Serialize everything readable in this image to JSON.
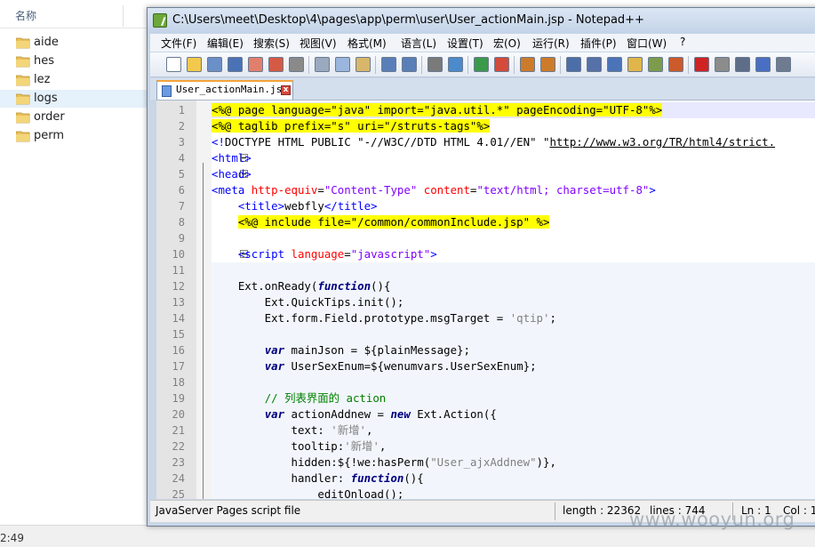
{
  "explorer": {
    "column_header": "名称",
    "folders": [
      "aide",
      "hes",
      "lez",
      "logs",
      "order",
      "perm"
    ],
    "selected_index": 3,
    "clock_fragment": "2:49"
  },
  "window": {
    "title": "C:\\Users\\meet\\Desktop\\4\\pages\\app\\perm\\user\\User_actionMain.jsp - Notepad++"
  },
  "menu": [
    "文件(F)",
    "编辑(E)",
    "搜索(S)",
    "视图(V)",
    "格式(M)",
    "语言(L)",
    "设置(T)",
    "宏(O)",
    "运行(R)",
    "插件(P)",
    "窗口(W)",
    "?"
  ],
  "toolbar": {
    "icons": [
      "new-file-icon",
      "open-file-icon",
      "save-icon",
      "save-all-icon",
      "close-icon",
      "close-all-icon",
      "print-icon",
      "cut-icon",
      "copy-icon",
      "paste-icon",
      "undo-icon",
      "redo-icon",
      "find-icon",
      "replace-icon",
      "zoom-in-icon",
      "zoom-out-icon",
      "sync-vertical-icon",
      "sync-horizontal-icon",
      "word-wrap-icon",
      "show-all-chars-icon",
      "indent-guide-icon",
      "user-lang-icon",
      "doc-map-icon",
      "function-list-icon",
      "record-macro-icon",
      "stop-macro-icon",
      "play-macro-icon",
      "run-macro-multiple-icon",
      "save-macro-icon"
    ]
  },
  "tab": {
    "label": "User_actionMain.jsp",
    "close": "x"
  },
  "editor": {
    "lines": [
      {
        "n": "1",
        "segs": [
          [
            "c-jsp",
            "<%@ page language=\"java\" import=\"java.util.*\" pageEncoding=\"UTF-8\"%>"
          ]
        ],
        "bg": "#e8e8ff"
      },
      {
        "n": "2",
        "segs": [
          [
            "c-jsp",
            "<%@ taglib prefix=\"s\" uri=\"/struts-tags\"%>"
          ]
        ],
        "bg": ""
      },
      {
        "n": "3",
        "segs": [
          [
            "c-tag",
            "<!"
          ],
          [
            "c-text",
            "DOCTYPE HTML PUBLIC \"-//W3C//DTD HTML 4.01//EN\" \""
          ],
          [
            "c-text",
            "http://www.w3.org/TR/html4/strict."
          ]
        ],
        "bg": ""
      },
      {
        "n": "4",
        "segs": [
          [
            "c-tag",
            "<html>"
          ]
        ],
        "bg": ""
      },
      {
        "n": "5",
        "segs": [
          [
            "c-tag",
            "<head>"
          ]
        ],
        "bg": ""
      },
      {
        "n": "6",
        "segs": [
          [
            "c-tag",
            "<meta "
          ],
          [
            "c-attr",
            "http-equiv"
          ],
          [
            "c-text",
            "="
          ],
          [
            "c-str",
            "\"Content-Type\""
          ],
          [
            "c-text",
            " "
          ],
          [
            "c-attr",
            "content"
          ],
          [
            "c-text",
            "="
          ],
          [
            "c-str",
            "\"text/html; charset=utf-8\""
          ],
          [
            "c-tag",
            ">"
          ]
        ],
        "bg": ""
      },
      {
        "n": "7",
        "segs": [
          [
            "c-text",
            "    "
          ],
          [
            "c-tag",
            "<title>"
          ],
          [
            "c-text",
            "webfly"
          ],
          [
            "c-tag",
            "</title>"
          ]
        ],
        "bg": ""
      },
      {
        "n": "8",
        "segs": [
          [
            "c-text",
            "    "
          ],
          [
            "c-jsp",
            "<%@ include file=\"/common/commonInclude.jsp\" %>"
          ]
        ],
        "bg": ""
      },
      {
        "n": "9",
        "segs": [
          [
            "c-text",
            ""
          ]
        ],
        "bg": ""
      },
      {
        "n": "10",
        "segs": [
          [
            "c-text",
            "    "
          ],
          [
            "c-tag",
            "<script "
          ],
          [
            "c-attr",
            "language"
          ],
          [
            "c-text",
            "="
          ],
          [
            "c-str",
            "\"javascript\""
          ],
          [
            "c-tag",
            ">"
          ]
        ],
        "bg": ""
      },
      {
        "n": "11",
        "segs": [
          [
            "c-text",
            ""
          ]
        ],
        "bg": "#f2f6fc"
      },
      {
        "n": "12",
        "segs": [
          [
            "c-text",
            "    Ext.onReady("
          ],
          [
            "c-kw",
            "function"
          ],
          [
            "c-text",
            "(){"
          ]
        ],
        "bg": "#f2f6fc"
      },
      {
        "n": "13",
        "segs": [
          [
            "c-text",
            "        Ext.QuickTips.init();"
          ]
        ],
        "bg": "#f2f6fc"
      },
      {
        "n": "14",
        "segs": [
          [
            "c-text",
            "        Ext.form.Field.prototype.msgTarget = "
          ],
          [
            "c-jsstr",
            "'qtip'"
          ],
          [
            "c-text",
            ";"
          ]
        ],
        "bg": "#f2f6fc"
      },
      {
        "n": "15",
        "segs": [
          [
            "c-text",
            ""
          ]
        ],
        "bg": "#f2f6fc"
      },
      {
        "n": "16",
        "segs": [
          [
            "c-text",
            "        "
          ],
          [
            "c-kw",
            "var"
          ],
          [
            "c-text",
            " mainJson = ${plainMessage};"
          ]
        ],
        "bg": "#f2f6fc"
      },
      {
        "n": "17",
        "segs": [
          [
            "c-text",
            "        "
          ],
          [
            "c-kw",
            "var"
          ],
          [
            "c-text",
            " UserSexEnum=${wenumvars.UserSexEnum};"
          ]
        ],
        "bg": "#f2f6fc"
      },
      {
        "n": "18",
        "segs": [
          [
            "c-text",
            ""
          ]
        ],
        "bg": "#f2f6fc"
      },
      {
        "n": "19",
        "segs": [
          [
            "c-text",
            "        "
          ],
          [
            "c-comment",
            "// 列表界面的 action"
          ]
        ],
        "bg": "#f2f6fc"
      },
      {
        "n": "20",
        "segs": [
          [
            "c-text",
            "        "
          ],
          [
            "c-kw",
            "var"
          ],
          [
            "c-text",
            " actionAddnew = "
          ],
          [
            "c-kw",
            "new"
          ],
          [
            "c-text",
            " Ext.Action({"
          ]
        ],
        "bg": "#f2f6fc"
      },
      {
        "n": "21",
        "segs": [
          [
            "c-text",
            "            text: "
          ],
          [
            "c-jsstr",
            "'新增'"
          ],
          [
            "c-text",
            ","
          ]
        ],
        "bg": "#f2f6fc"
      },
      {
        "n": "22",
        "segs": [
          [
            "c-text",
            "            tooltip:"
          ],
          [
            "c-jsstr",
            "'新增'"
          ],
          [
            "c-text",
            ","
          ]
        ],
        "bg": "#f2f6fc"
      },
      {
        "n": "23",
        "segs": [
          [
            "c-text",
            "            hidden:${!we:hasPerm("
          ],
          [
            "c-jsstr",
            "\"User_ajxAddnew\""
          ],
          [
            "c-text",
            ")},"
          ]
        ],
        "bg": "#f2f6fc"
      },
      {
        "n": "24",
        "segs": [
          [
            "c-text",
            "            handler: "
          ],
          [
            "c-kw",
            "function"
          ],
          [
            "c-text",
            "(){"
          ]
        ],
        "bg": "#f2f6fc"
      },
      {
        "n": "25",
        "segs": [
          [
            "c-text",
            "                editOnload();"
          ]
        ],
        "bg": "#f2f6fc"
      }
    ]
  },
  "status": {
    "file_type": "JavaServer Pages script file",
    "length": "length : 22362",
    "lines": "lines : 744",
    "ln": "Ln : 1",
    "col": "Col : 1"
  },
  "watermark": "www.wooyun.org"
}
